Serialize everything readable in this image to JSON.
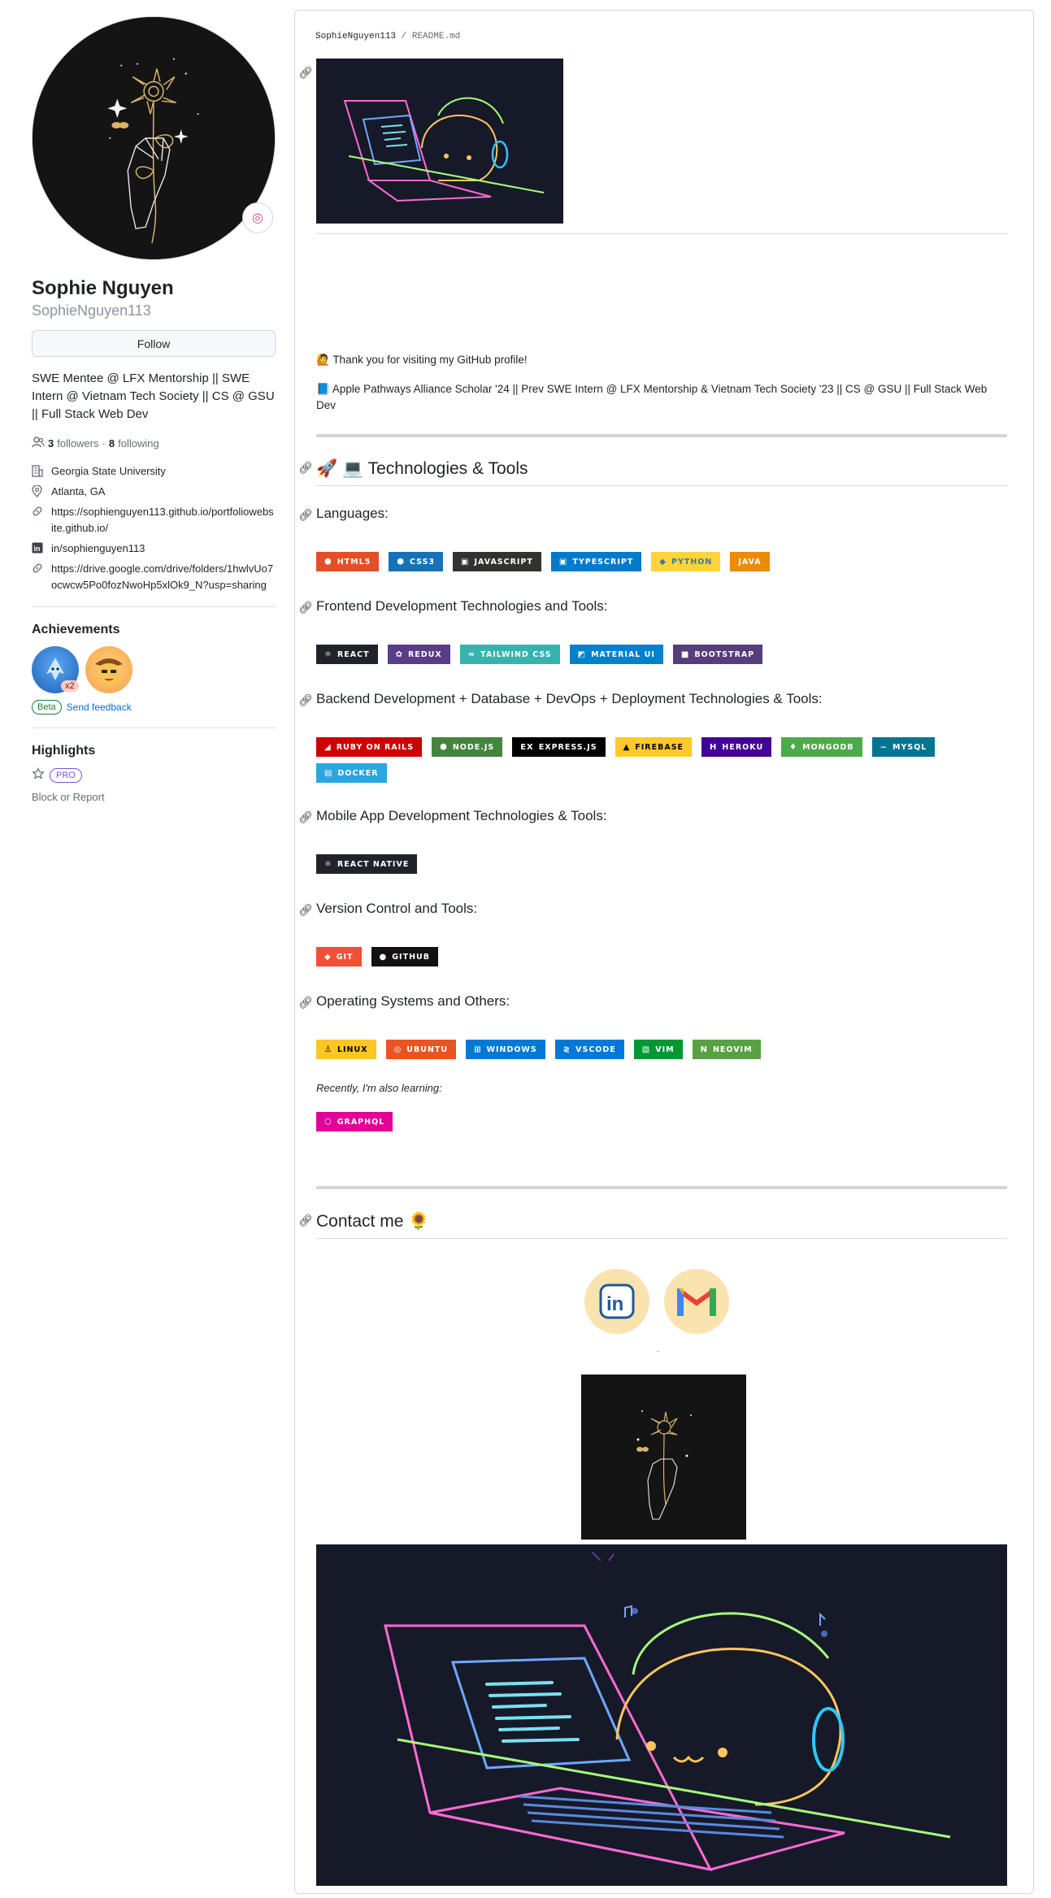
{
  "profile": {
    "name": "Sophie Nguyen",
    "login": "SophieNguyen113",
    "follow_label": "Follow",
    "bio": "SWE Mentee @ LFX Mentorship || SWE Intern @ Vietnam Tech Society || CS @ GSU || Full Stack Web Dev",
    "followers_count": "3",
    "followers_label": "followers",
    "separator": "·",
    "following_count": "8",
    "following_label": "following",
    "details": {
      "org": "Georgia State University",
      "location": "Atlanta, GA",
      "website": "https://sophienguyen113.github.io/portfoliowebsite.github.io/",
      "linkedin": "in/sophienguyen113",
      "drive": "https://drive.google.com/drive/folders/1hwlvUo7ocwcw5Po0fozNwoHp5xlOk9_N?usp=sharing"
    },
    "achievements_title": "Achievements",
    "achievement_multiplier": "x2",
    "beta_label": "Beta",
    "feedback_label": "Send feedback",
    "highlights_title": "Highlights",
    "pro_label": "PRO",
    "block_label": "Block or Report"
  },
  "readme": {
    "owner": "SophieNguyen113",
    "slash": "/",
    "file": "README.md",
    "thanks": "🙋 Thank you for visiting my GitHub profile!",
    "bio_line": "📘 Apple Pathways Alliance Scholar '24 || Prev SWE Intern @ LFX Mentorship & Vietnam Tech Society '23 || CS @ GSU || Full Stack Web Dev",
    "tech_heading": "🚀 💻 Technologies & Tools",
    "sections": {
      "languages": "Languages:",
      "frontend": "Frontend Development Technologies and Tools:",
      "backend": "Backend Development + Database + DevOps + Deployment Technologies & Tools:",
      "mobile": "Mobile App Development Technologies & Tools:",
      "vcs": "Version Control and Tools:",
      "os": "Operating Systems and Others:"
    },
    "learning": "Recently, I'm also learning:",
    "contact_heading": "Contact me 🌻",
    "badges": {
      "languages": [
        {
          "label": "HTML5",
          "color": "#e34f26",
          "icon": "html5-icon",
          "glyph": "⬢"
        },
        {
          "label": "CSS3",
          "color": "#1572b6",
          "icon": "css3-icon",
          "glyph": "⬢"
        },
        {
          "label": "JAVASCRIPT",
          "color": "#323330",
          "icon": "javascript-icon",
          "glyph": "▣"
        },
        {
          "label": "TYPESCRIPT",
          "color": "#007acc",
          "icon": "typescript-icon",
          "glyph": "▣"
        },
        {
          "label": "PYTHON",
          "color": "#ffd43b",
          "icon": "python-icon",
          "glyph": "◆",
          "text": "#3776ab"
        },
        {
          "label": "JAVA",
          "color": "#ed8b00",
          "icon": "java-icon",
          "glyph": ""
        }
      ],
      "frontend": [
        {
          "label": "REACT",
          "color": "#20232a",
          "icon": "react-icon",
          "glyph": "⚛"
        },
        {
          "label": "REDUX",
          "color": "#593d88",
          "icon": "redux-icon",
          "glyph": "✿"
        },
        {
          "label": "TAILWIND CSS",
          "color": "#38b2ac",
          "icon": "tailwind-icon",
          "glyph": "≈"
        },
        {
          "label": "MATERIAL UI",
          "color": "#0081cb",
          "icon": "material-ui-icon",
          "glyph": "◩"
        },
        {
          "label": "BOOTSTRAP",
          "color": "#563d7c",
          "icon": "bootstrap-icon",
          "glyph": "■"
        }
      ],
      "backend": [
        {
          "label": "RUBY ON RAILS",
          "color": "#cc0000",
          "icon": "rails-icon",
          "glyph": "◢"
        },
        {
          "label": "NODE.JS",
          "color": "#43853d",
          "icon": "nodejs-icon",
          "glyph": "⬢"
        },
        {
          "label": "EXPRESS.JS",
          "color": "#000000",
          "icon": "express-icon",
          "glyph": "ex"
        },
        {
          "label": "FIREBASE",
          "color": "#ffca28",
          "icon": "firebase-icon",
          "glyph": "▲",
          "text": "#000000"
        },
        {
          "label": "HEROKU",
          "color": "#430098",
          "icon": "heroku-icon",
          "glyph": "H"
        },
        {
          "label": "MONGODB",
          "color": "#4ea94b",
          "icon": "mongodb-icon",
          "glyph": "♦"
        },
        {
          "label": "MYSQL",
          "color": "#00758f",
          "icon": "mysql-icon",
          "glyph": "~"
        },
        {
          "label": "DOCKER",
          "color": "#2ca5e0",
          "icon": "docker-icon",
          "glyph": "▤"
        }
      ],
      "mobile": [
        {
          "label": "REACT NATIVE",
          "color": "#20232a",
          "icon": "react-native-icon",
          "glyph": "⚛"
        }
      ],
      "vcs": [
        {
          "label": "GIT",
          "color": "#f05033",
          "icon": "git-icon",
          "glyph": "◆"
        },
        {
          "label": "GITHUB",
          "color": "#121011",
          "icon": "github-icon",
          "glyph": "●"
        }
      ],
      "os": [
        {
          "label": "LINUX",
          "color": "#fcc624",
          "icon": "linux-icon",
          "glyph": "♙",
          "text": "#000000"
        },
        {
          "label": "UBUNTU",
          "color": "#e95420",
          "icon": "ubuntu-icon",
          "glyph": "◎"
        },
        {
          "label": "WINDOWS",
          "color": "#0078d6",
          "icon": "windows-icon",
          "glyph": "⊞"
        },
        {
          "label": "VSCODE",
          "color": "#0078d7",
          "icon": "vscode-icon",
          "glyph": "≷"
        },
        {
          "label": "VIM",
          "color": "#019733",
          "icon": "vim-icon",
          "glyph": "▧"
        },
        {
          "label": "NEOVIM",
          "color": "#57a143",
          "icon": "neovim-icon",
          "glyph": "N"
        }
      ],
      "learning": [
        {
          "label": "GRAPHQL",
          "color": "#e10098",
          "icon": "graphql-icon",
          "glyph": "⬡"
        }
      ]
    }
  }
}
